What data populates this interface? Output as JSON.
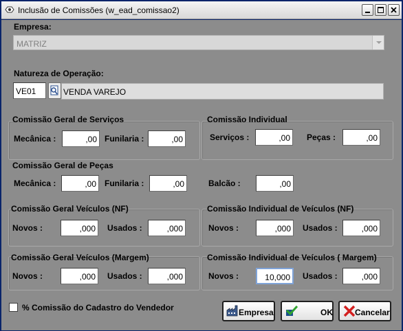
{
  "window": {
    "title": "Inclusão de Comissões (w_ead_comissao2)"
  },
  "empresa": {
    "label": "Empresa:",
    "value": "MATRIZ"
  },
  "natureza": {
    "label": "Natureza de Operação:",
    "code": "VE01",
    "description": "VENDA VAREJO"
  },
  "geral_servicos": {
    "title": "Comissão Geral de Serviços",
    "mecanica_label": "Mecânica :",
    "mecanica_value": ",00",
    "funilaria_label": "Funilaria :",
    "funilaria_value": ",00"
  },
  "individual": {
    "title": "Comissão Individual",
    "servicos_label": "Serviços :",
    "servicos_value": ",00",
    "pecas_label": "Peças :",
    "pecas_value": ",00"
  },
  "geral_pecas": {
    "title": "Comissão Geral de Peças",
    "mecanica_label": "Mecânica :",
    "mecanica_value": ",00",
    "funilaria_label": "Funilaria :",
    "funilaria_value": ",00",
    "balcao_label": "Balcão :",
    "balcao_value": ",00"
  },
  "geral_veiculos_nf": {
    "title": "Comissão Geral Veículos (NF)",
    "novos_label": "Novos :",
    "novos_value": ",000",
    "usados_label": "Usados :",
    "usados_value": ",000"
  },
  "individual_veiculos_nf": {
    "title": "Comissão Individual de Veículos (NF)",
    "novos_label": "Novos :",
    "novos_value": ",000",
    "usados_label": "Usados :",
    "usados_value": ",000"
  },
  "geral_veiculos_margem": {
    "title": "Comissão Geral Veículos (Margem)",
    "novos_label": "Novos :",
    "novos_value": ",000",
    "usados_label": "Usados :",
    "usados_value": ",000"
  },
  "individual_veiculos_margem": {
    "title": "Comissão Individual de Veículos ( Margem)",
    "novos_label": "Novos :",
    "novos_value": "10,000",
    "usados_label": "Usados :",
    "usados_value": ",000"
  },
  "checkbox": {
    "label": "% Comissão do Cadastro do Vendedor",
    "checked": false
  },
  "buttons": {
    "empresa": "Empresa",
    "ok": "OK",
    "cancelar": "Cancelar"
  }
}
